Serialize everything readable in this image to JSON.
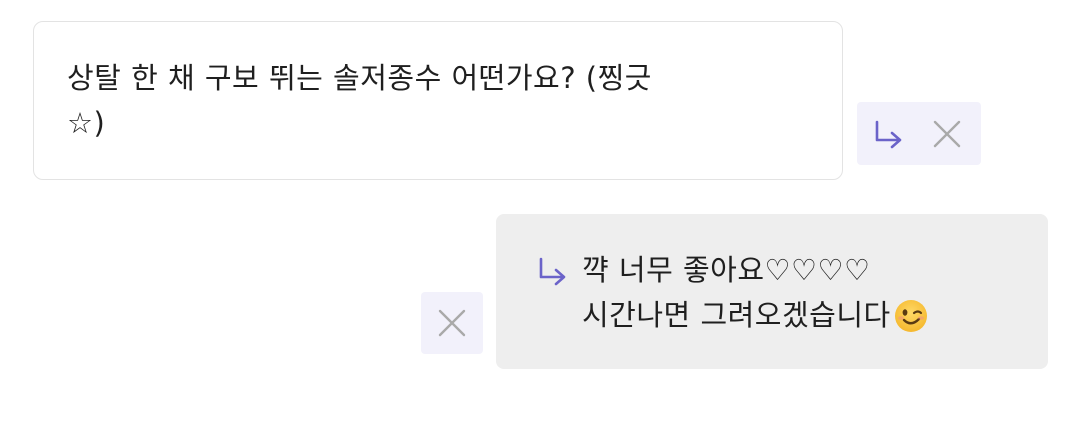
{
  "comment": {
    "text": "상탈 한 채 구보 뛰는 솔저종수 어떤가요? (찡긋\n☆)"
  },
  "reply": {
    "line1": "꺅 너무 좋아요♡♡♡♡",
    "line2": "시간나면 그려오겠습니다"
  },
  "icons": {
    "reply_arrow": "reply-arrow-icon",
    "close": "close-icon",
    "emoji": "winking-face-emoji"
  },
  "colors": {
    "accent": "#6b63c9",
    "action_bg": "#f2f1fb",
    "reply_bg": "#eeeeee",
    "close_gray": "#a9a9a9"
  }
}
